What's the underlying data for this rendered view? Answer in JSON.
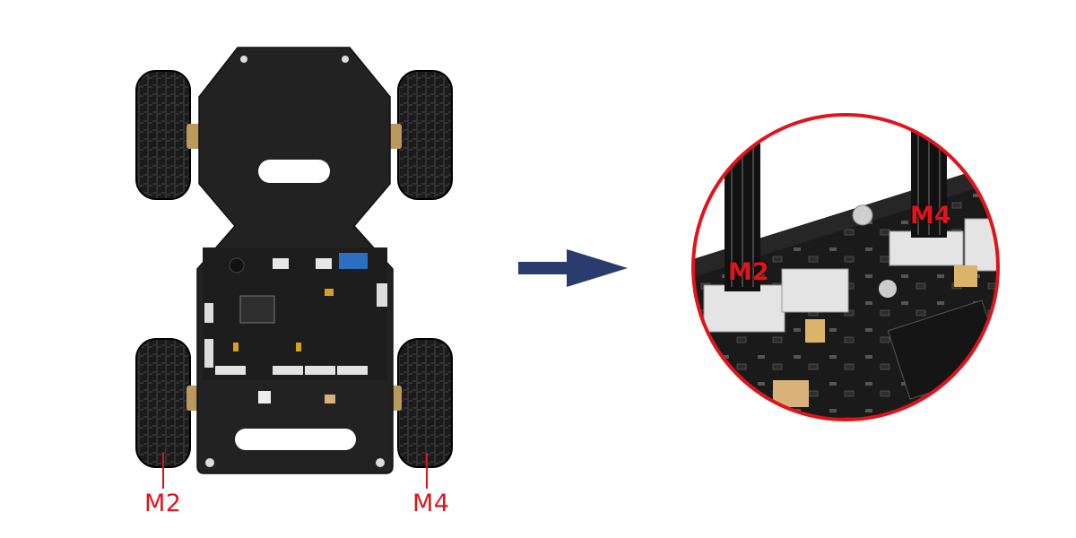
{
  "robot": {
    "motor_left_label": "M2",
    "motor_right_label": "M4"
  },
  "zoom_view": {
    "motor_left_label": "M2",
    "motor_right_label": "M4"
  },
  "colors": {
    "label_red": "#e0141b",
    "arrow_blue": "#2a3c6e",
    "board_black": "#1c1c1c",
    "circle_border": "#e0141b"
  }
}
